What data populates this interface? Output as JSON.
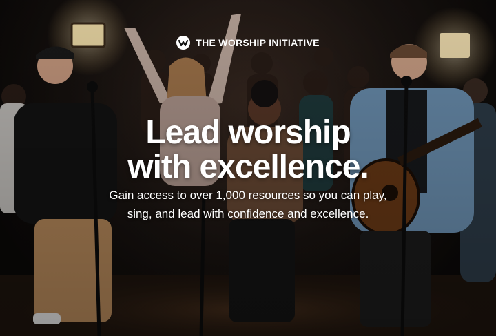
{
  "brand": {
    "name": "THE WORSHIP INITIATIVE",
    "logo_icon": "worship-initiative-logo-icon"
  },
  "hero": {
    "headline_line1": "Lead worship",
    "headline_line2": "with excellence.",
    "subtext_line1": "Gain access to over 1,000 resources so you can play,",
    "subtext_line2": "sing, and lead with confidence and excellence."
  }
}
